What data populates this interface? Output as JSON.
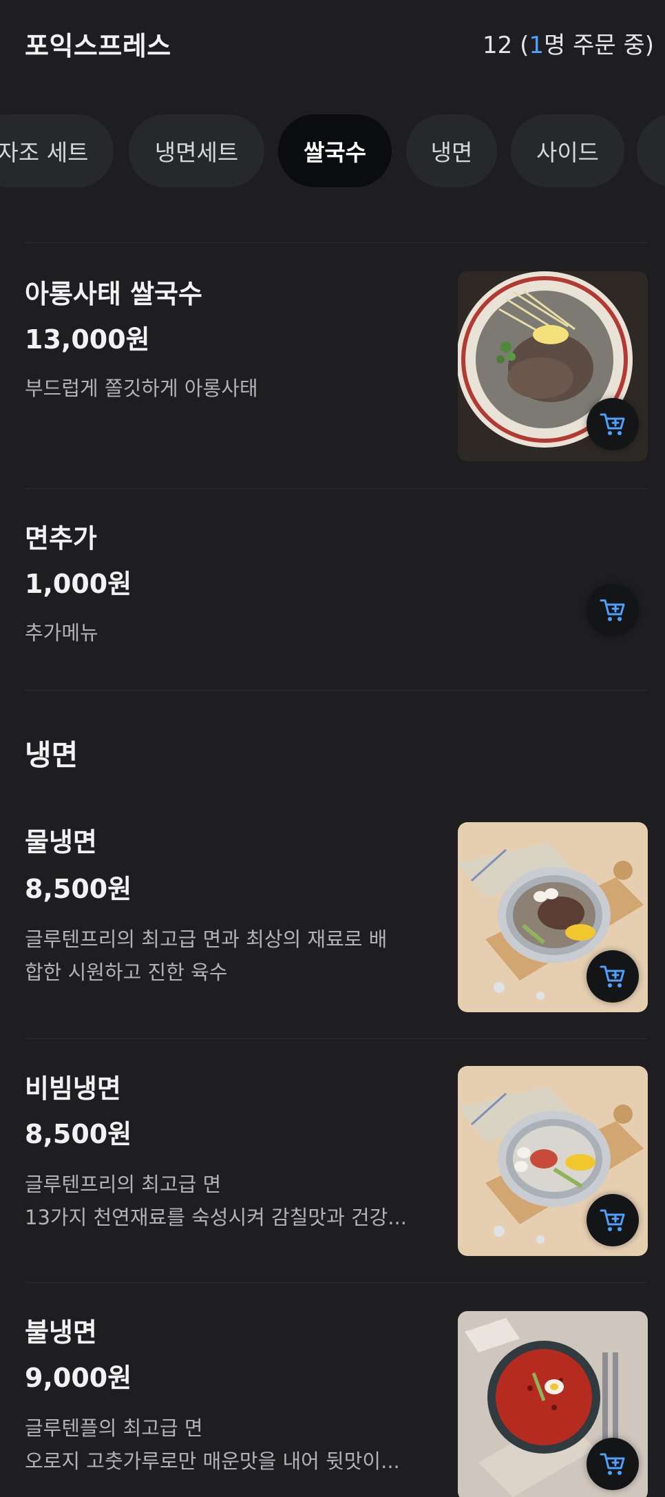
{
  "header": {
    "store_name": "포익스프레스",
    "order_prefix": "12 (",
    "order_highlight": "1",
    "order_suffix": "명 주문 중)"
  },
  "tabs": [
    {
      "label": "자조 세트",
      "active": false
    },
    {
      "label": "냉면세트",
      "active": false
    },
    {
      "label": "쌀국수",
      "active": true
    },
    {
      "label": "냉면",
      "active": false
    },
    {
      "label": "사이드",
      "active": false
    }
  ],
  "colors": {
    "background": "#1e1e20",
    "accent_blue": "#4ea1ff",
    "tab_active_bg": "#0b0c0d",
    "tab_bg": "#26282b"
  },
  "menu": {
    "pho_items": [
      {
        "name": "아롱사태 쌀국수",
        "price": "13,000원",
        "desc_lines": [
          "부드럽게 쫄깃하게 아롱사태"
        ],
        "icon": "cart-add-icon"
      },
      {
        "name": "면추가",
        "price": "1,000원",
        "desc_lines": [
          "추가메뉴"
        ],
        "icon": "cart-add-icon"
      }
    ],
    "naengmyeon_section_title": "냉면",
    "naengmyeon_items": [
      {
        "name": "물냉면",
        "price": "8,500원",
        "desc_lines": [
          "글루텐프리의 최고급 면과 최상의 재료로 배",
          "합한 시원하고 진한 육수"
        ],
        "icon": "cart-add-icon"
      },
      {
        "name": "비빔냉면",
        "price": "8,500원",
        "desc_lines": [
          "글루텐프리의 최고급 면",
          "13가지 천연재료를 숙성시켜 감칠맛과 건강..."
        ],
        "icon": "cart-add-icon"
      },
      {
        "name": "불냉면",
        "price": "9,000원",
        "desc_lines": [
          "글루텐플의 최고급 면",
          "오로지 고춧가루로만 매운맛을 내어 뒷맛이..."
        ],
        "icon": "cart-add-icon"
      }
    ]
  }
}
